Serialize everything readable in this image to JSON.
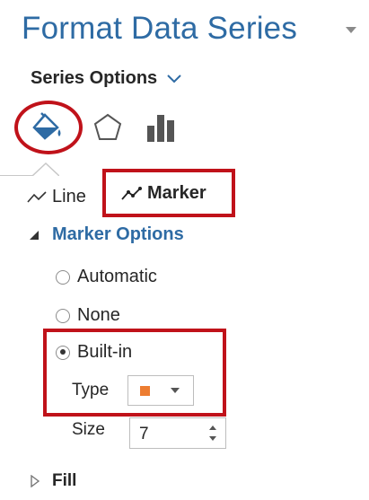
{
  "pane": {
    "title": "Format Data Series",
    "series_options_label": "Series Options",
    "icons": [
      "fill-line-icon",
      "effects-pentagon-icon",
      "series-options-bars-icon"
    ]
  },
  "subtabs": {
    "line_label": "Line",
    "marker_label": "Marker"
  },
  "marker_options": {
    "header": "Marker Options",
    "automatic_label": "Automatic",
    "none_label": "None",
    "builtin_label": "Built-in",
    "selected": "Built-in",
    "type_label": "Type",
    "type_color": "#ed7d31",
    "size_label": "Size",
    "size_value": "7"
  },
  "fill_section": {
    "label": "Fill"
  },
  "colors": {
    "accent_blue": "#2e6ba4",
    "highlight_red": "#c0121a",
    "marker_orange": "#ed7d31"
  }
}
